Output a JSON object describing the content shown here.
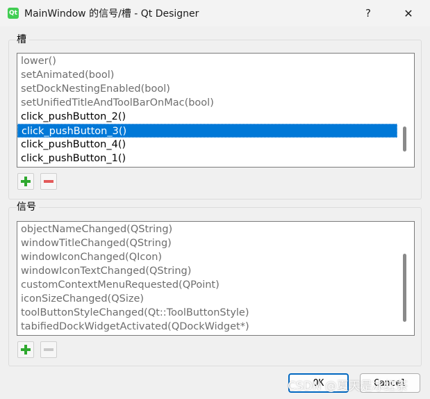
{
  "window": {
    "title": "MainWindow 的信号/槽 - Qt Designer",
    "app_icon_text": "Qt",
    "help_label": "?",
    "close_label": "✕"
  },
  "slots": {
    "label": "槽",
    "items": [
      {
        "text": "lower()",
        "state": "muted"
      },
      {
        "text": "setAnimated(bool)",
        "state": "muted"
      },
      {
        "text": "setDockNestingEnabled(bool)",
        "state": "muted"
      },
      {
        "text": "setUnifiedTitleAndToolBarOnMac(bool)",
        "state": "muted"
      },
      {
        "text": "click_pushButton_2()",
        "state": "normal"
      },
      {
        "text": "click_pushButton_3()",
        "state": "selected"
      },
      {
        "text": "click_pushButton_4()",
        "state": "normal"
      },
      {
        "text": "click_pushButton_1()",
        "state": "normal"
      }
    ]
  },
  "signals": {
    "label": "信号",
    "items": [
      {
        "text": "objectNameChanged(QString)",
        "state": "muted"
      },
      {
        "text": "windowTitleChanged(QString)",
        "state": "muted"
      },
      {
        "text": "windowIconChanged(QIcon)",
        "state": "muted"
      },
      {
        "text": "windowIconTextChanged(QString)",
        "state": "muted"
      },
      {
        "text": "customContextMenuRequested(QPoint)",
        "state": "muted"
      },
      {
        "text": "iconSizeChanged(QSize)",
        "state": "muted"
      },
      {
        "text": "toolButtonStyleChanged(Qt::ToolButtonStyle)",
        "state": "muted"
      },
      {
        "text": "tabifiedDockWidgetActivated(QDockWidget*)",
        "state": "muted"
      }
    ]
  },
  "buttons": {
    "ok_label": "OK",
    "cancel_label": "Cancel"
  },
  "watermark": "CSDN @夏天是冰红茶",
  "colors": {
    "selection": "#0078d7",
    "add_icon": "#2fa82f",
    "remove_icon": "#e35a5a"
  }
}
